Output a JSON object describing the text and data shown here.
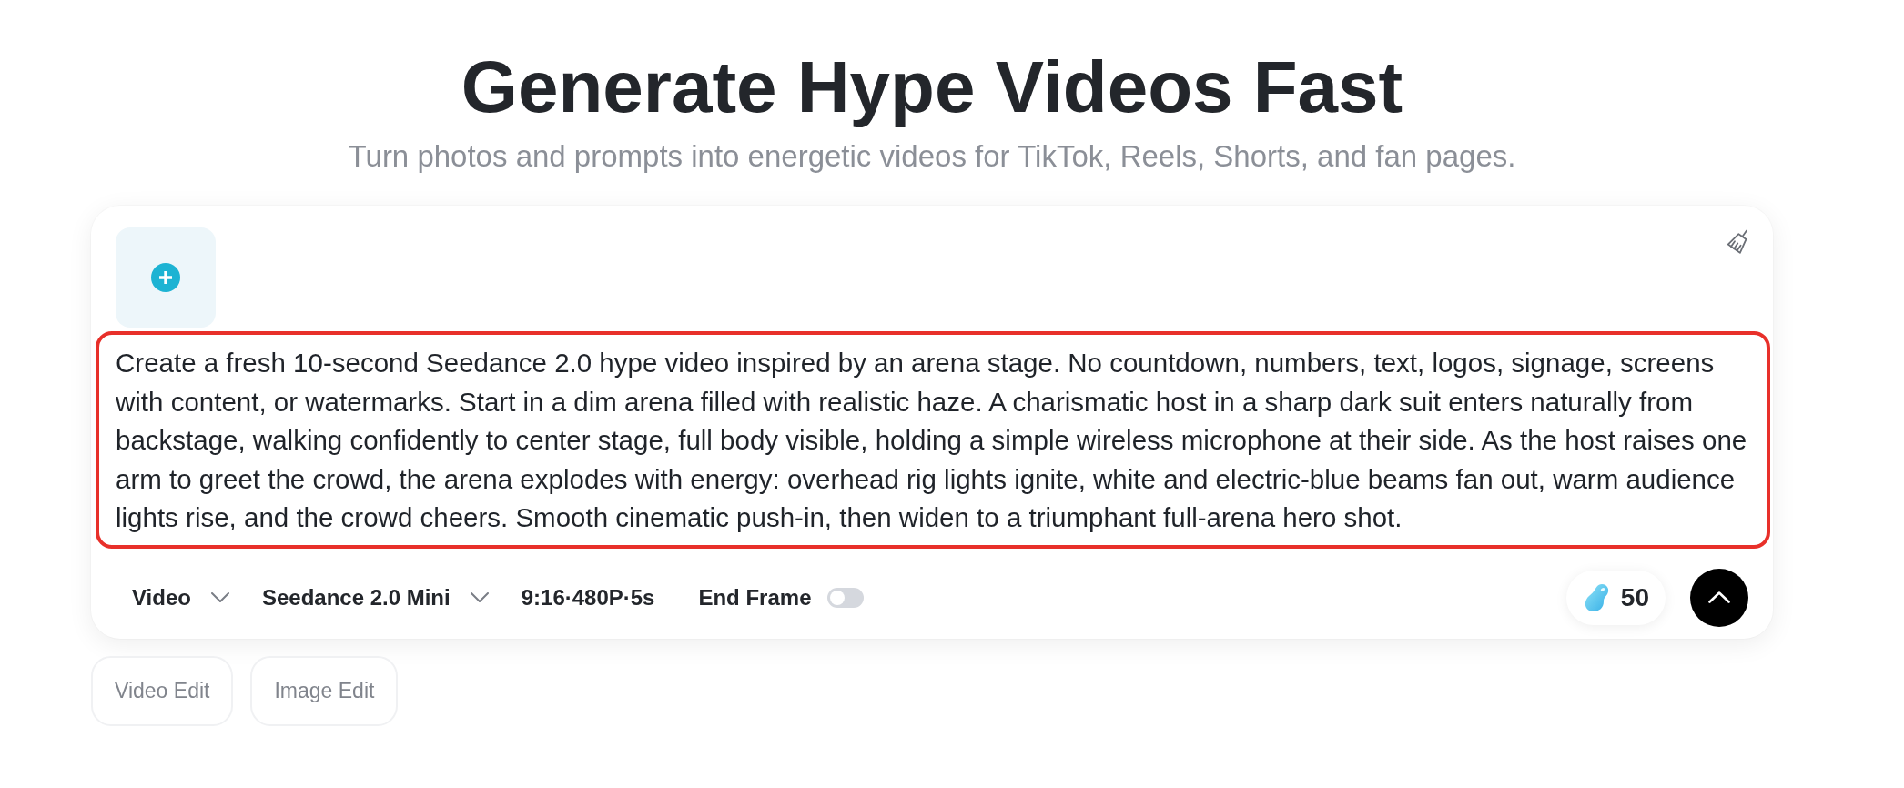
{
  "header": {
    "title": "Generate Hype Videos Fast",
    "subtitle": "Turn photos and prompts into energetic videos for TikTok, Reels, Shorts, and fan pages."
  },
  "composer": {
    "prompt": "Create a fresh 10-second Seedance 2.0 hype video inspired by an arena stage. No countdown, numbers, text, logos, signage, screens with content, or watermarks. Start in a dim arena filled with realistic haze. A charismatic host in a sharp dark suit enters naturally from backstage, walking confidently to center stage, full body visible, holding a simple wireless microphone at their side. As the host raises one arm to greet the crowd, the arena explodes with energy: overhead rig lights ignite, white and electric-blue beams fan out, warm audience lights rise, and the crowd cheers. Smooth cinematic push-in, then widen to a triumphant full-arena hero shot.",
    "focused": true,
    "toolbar": [
      {
        "kind": "dropdown",
        "label": "Video"
      },
      {
        "kind": "dropdown",
        "label": "Seedance 2.0 Mini"
      },
      {
        "kind": "text",
        "label": "9:16·480P·5s"
      },
      {
        "kind": "toggle",
        "label": "End Frame",
        "on": false
      }
    ],
    "credits": "50"
  },
  "shortcuts": [
    {
      "label": "Video Edit"
    },
    {
      "label": "Image Edit"
    }
  ]
}
